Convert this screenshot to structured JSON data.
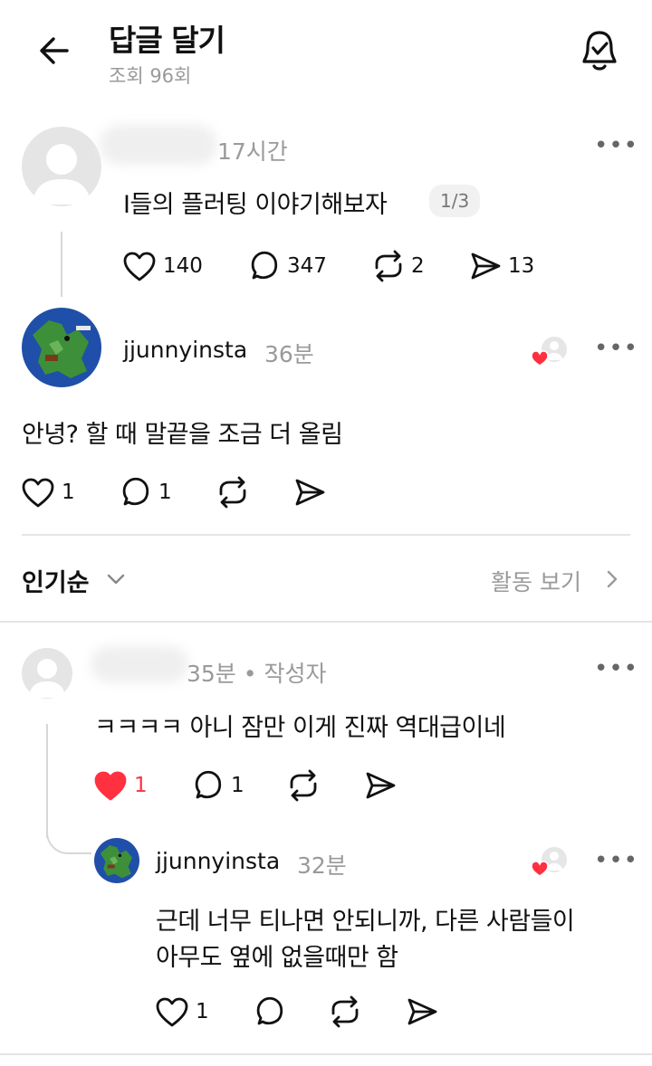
{
  "header": {
    "title": "답글 달기",
    "views": "조회 96회"
  },
  "original_post": {
    "time": "17시간",
    "text": "I들의 플러팅 이야기해보자",
    "page_badge": "1/3",
    "likes": "140",
    "replies": "347",
    "reposts": "2",
    "shares": "13"
  },
  "reply_1": {
    "username": "jjunnyinsta",
    "time": "36분",
    "text": "안녕? 할 때 말끝을 조금 더 올림",
    "likes": "1",
    "replies": "1"
  },
  "sort_bar": {
    "label": "인기순",
    "activity_label": "활동 보기"
  },
  "comment_1": {
    "time": "35분 • 작성자",
    "text": "ㅋㅋㅋㅋ 아니 잠만 이게 진짜 역대급이네",
    "likes": "1",
    "replies": "1",
    "like_color": "#ff3040"
  },
  "comment_2": {
    "username": "jjunnyinsta",
    "time": "32분",
    "text_line1": "근데 너무 티나면 안되니까, 다른 사람들이",
    "text_line2": "아무도 옆에 없을때만 함",
    "likes": "1"
  },
  "icons": {
    "back": "back-arrow-icon",
    "notify": "notification-check-icon",
    "like": "heart-icon",
    "reply": "comment-bubble-icon",
    "repost": "repost-icon",
    "share": "send-icon",
    "more": "more-dots-icon",
    "liked_by_author": "liked-by-author-icon"
  }
}
